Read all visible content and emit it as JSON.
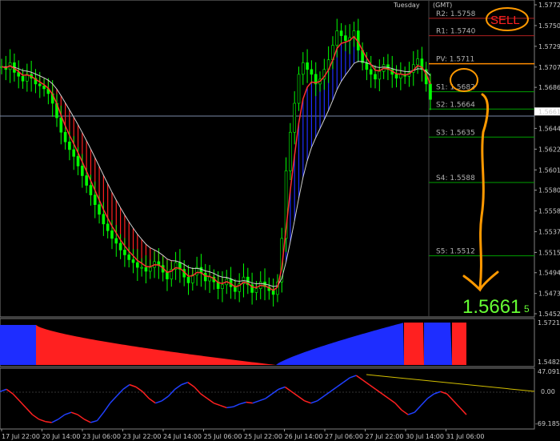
{
  "header": {
    "day_label": "Tuesday",
    "tz_label": "(GMT)"
  },
  "sell_label": "SELL",
  "current_price": {
    "big": "1.5661",
    "small": "5"
  },
  "main_axis": {
    "ticks": [
      "1.57720",
      "1.57505",
      "1.57290",
      "1.57075",
      "1.56865",
      "1.56615",
      "1.56440",
      "1.56225",
      "1.56010",
      "1.55800",
      "1.55585",
      "1.55370",
      "1.55155",
      "1.54945",
      "1.54730",
      "1.54520"
    ],
    "current_tick": "1.56615"
  },
  "pivots": [
    {
      "name": "R2",
      "label": "R2: 1.5758",
      "price": 1.5758
    },
    {
      "name": "R1",
      "label": "R1: 1.5740",
      "price": 1.574
    },
    {
      "name": "PV",
      "label": "PV: 1.5711",
      "price": 1.5711
    },
    {
      "name": "S1",
      "label": "S1: 1.5682",
      "price": 1.5682
    },
    {
      "name": "S2",
      "label": "S2: 1.5664",
      "price": 1.5664
    },
    {
      "name": "S3",
      "label": "S3: 1.5635",
      "price": 1.5635
    },
    {
      "name": "S4",
      "label": "S4: 1.5588",
      "price": 1.5588
    },
    {
      "name": "S5",
      "label": "S5: 1.5512",
      "price": 1.5512
    }
  ],
  "pane2_axis": {
    "top": "1.5721",
    "bottom": "1.5482"
  },
  "pane3_axis": {
    "top": "47.091",
    "mid": "0.00",
    "bottom": "-69.1855"
  },
  "time_labels": [
    "17 Jul 22:00",
    "20 Jul 14:00",
    "23 Jul 06:00",
    "23 Jul 22:00",
    "24 Jul 14:00",
    "25 Jul 06:00",
    "25 Jul 22:00",
    "26 Jul 14:00",
    "27 Jul 06:00",
    "27 Jul 22:00",
    "30 Jul 14:00",
    "31 Jul 06:00"
  ],
  "colors": {
    "bull": "#00ff00",
    "band_up": "#1e2dff",
    "band_down": "#ff2020",
    "pivot_line": "#00a000",
    "r_line": "#b02020",
    "pv_line": "#ff8c00",
    "annot": "#ff9900",
    "grid": "#6a7a9a"
  },
  "chart_data": {
    "type": "candlestick",
    "ylim": [
      1.5452,
      1.5772
    ],
    "close_series": [
      1.5708,
      1.5705,
      1.5712,
      1.5702,
      1.5698,
      1.5693,
      1.57,
      1.5696,
      1.569,
      1.5688,
      1.5685,
      1.568,
      1.567,
      1.5655,
      1.564,
      1.563,
      1.5622,
      1.5615,
      1.5605,
      1.5595,
      1.5585,
      1.5575,
      1.5565,
      1.5555,
      1.5545,
      1.5538,
      1.553,
      1.5525,
      1.5518,
      1.5513,
      1.5508,
      1.5505,
      1.55,
      1.55,
      1.5496,
      1.55,
      1.5506,
      1.5502,
      1.5495,
      1.5488,
      1.5498,
      1.5505,
      1.5498,
      1.549,
      1.5484,
      1.5492,
      1.55,
      1.5494,
      1.5486,
      1.549,
      1.5485,
      1.5478,
      1.5482,
      1.5488,
      1.548,
      1.5475,
      1.5483,
      1.549,
      1.5482,
      1.5474,
      1.5478,
      1.5485,
      1.548,
      1.5476,
      1.5472,
      1.5485,
      1.553,
      1.56,
      1.564,
      1.567,
      1.57,
      1.5712,
      1.5705,
      1.57,
      1.569,
      1.5695,
      1.5705,
      1.5715,
      1.573,
      1.5745,
      1.574,
      1.5735,
      1.5738,
      1.5745,
      1.5725,
      1.5712,
      1.5705,
      1.57,
      1.5695,
      1.5703,
      1.571,
      1.5705,
      1.57,
      1.5696,
      1.57,
      1.5698,
      1.5702,
      1.571,
      1.5716,
      1.5705,
      1.569,
      1.5674
    ],
    "histogram_pane": {
      "type": "area",
      "ylim": [
        1.5482,
        1.5721
      ],
      "segments_color": [
        "blue",
        "red",
        "blue",
        "red",
        "blue",
        "red"
      ]
    },
    "oscillator_pane": {
      "type": "line",
      "ylim": [
        -69.1855,
        47.091
      ],
      "values": [
        5,
        10,
        0,
        -15,
        -30,
        -45,
        -55,
        -60,
        -62,
        -55,
        -45,
        -40,
        -45,
        -55,
        -62,
        -58,
        -40,
        -20,
        -5,
        10,
        20,
        15,
        5,
        -10,
        -20,
        -15,
        -5,
        10,
        20,
        25,
        15,
        0,
        -10,
        -20,
        -25,
        -30,
        -28,
        -22,
        -18,
        -20,
        -15,
        -10,
        0,
        10,
        15,
        5,
        -5,
        -15,
        -20,
        -15,
        -5,
        5,
        15,
        25,
        35,
        40,
        30,
        20,
        10,
        0,
        -10,
        -20,
        -35,
        -45,
        -40,
        -25,
        -10,
        0,
        5,
        0,
        -15,
        -30,
        -45
      ],
      "trendline": [
        47.091,
        0.0
      ]
    }
  }
}
